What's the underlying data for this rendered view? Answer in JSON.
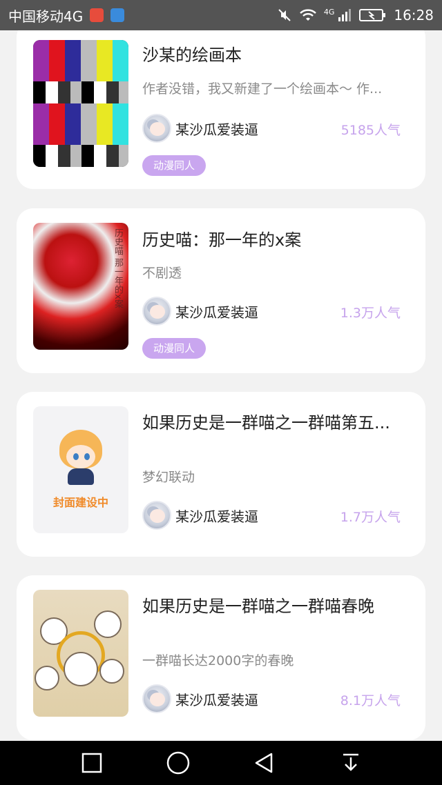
{
  "status_bar": {
    "carrier": "中国移动4G",
    "net_label": "4G",
    "time": "16:28"
  },
  "books": [
    {
      "title": "沙某的绘画本",
      "description": "作者没错，我又新建了一个绘画本～ 作...",
      "author": "某沙瓜爱装逼",
      "popularity": "5185人气",
      "tag": "动漫同人"
    },
    {
      "title": "历史喵：那一年的x案",
      "description": "不剧透",
      "author": "某沙瓜爱装逼",
      "popularity": "1.3万人气",
      "tag": "动漫同人",
      "cover_text": "历史喵 那一年的x案"
    },
    {
      "title": "如果历史是一群喵之一群喵第五...",
      "description": "梦幻联动",
      "author": "某沙瓜爱装逼",
      "popularity": "1.7万人气",
      "cover_text": "封面建设中"
    },
    {
      "title": "如果历史是一群喵之一群喵春晚",
      "description": "一群喵长达2000字的春晚",
      "author": "某沙瓜爱装逼",
      "popularity": "8.1万人气"
    }
  ],
  "colors": {
    "tag_bg": "#c9a6ef",
    "popularity": "#c6a3ec",
    "status_bar_bg": "#545454"
  }
}
